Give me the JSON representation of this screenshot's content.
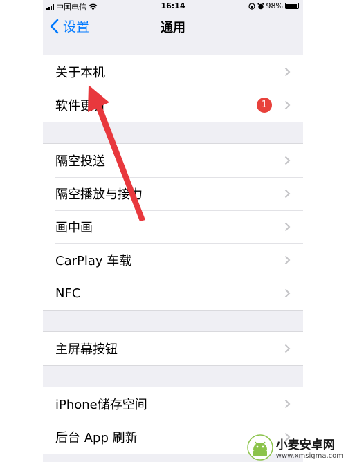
{
  "status": {
    "carrier": "中国电信",
    "time": "16:14",
    "battery": "98%"
  },
  "nav": {
    "back_label": "设置",
    "title": "通用"
  },
  "groups": [
    {
      "rows": [
        {
          "label": "关于本机"
        },
        {
          "label": "软件更新",
          "badge": "1"
        }
      ]
    },
    {
      "rows": [
        {
          "label": "隔空投送"
        },
        {
          "label": "隔空播放与接力"
        },
        {
          "label": "画中画"
        },
        {
          "label": "CarPlay 车载"
        },
        {
          "label": "NFC"
        }
      ]
    },
    {
      "rows": [
        {
          "label": "主屏幕按钮"
        }
      ]
    },
    {
      "rows": [
        {
          "label": "iPhone储存空间"
        },
        {
          "label": "后台 App 刷新"
        }
      ]
    }
  ],
  "watermark": {
    "name": "小麦安卓网",
    "url": "www.xmsigma.com"
  },
  "colors": {
    "accent": "#007aff",
    "badge": "#e8413b",
    "annotation_arrow": "#e8383d",
    "background": "#efeff4"
  },
  "icons": {
    "back": "chevron-left-icon",
    "disclosure": "chevron-right-icon",
    "wifi": "wifi-icon",
    "alarm": "alarm-icon",
    "lock_rotation": "orientation-lock-icon"
  }
}
